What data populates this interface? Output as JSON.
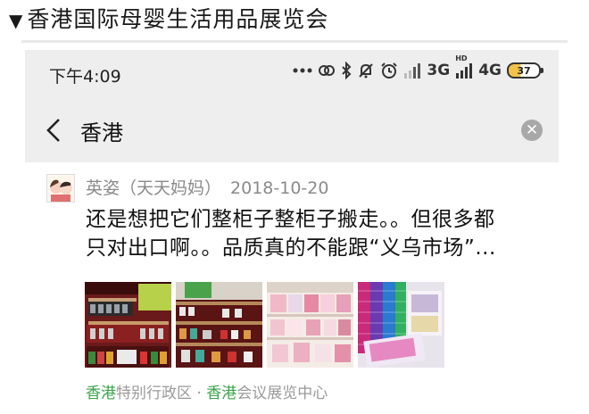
{
  "headline": {
    "marker": "▼",
    "text": "香港国际母婴生活用品展览会"
  },
  "status_bar": {
    "time": "下午4:09",
    "icons": [
      "more-dots-icon",
      "link-icon",
      "bluetooth-icon",
      "mute-bell-icon",
      "alarm-clock-icon",
      "signal-icon",
      "signal-icon"
    ],
    "network_1": "3G",
    "network_1_sup": "HD",
    "network_2": "4G",
    "battery": "37",
    "battery_color": "#f3c24a"
  },
  "search": {
    "query": "香港",
    "back_icon": "chevron-left-icon",
    "clear_icon": "clear-circle-icon"
  },
  "post": {
    "author": "英姿（天天妈妈）",
    "date": "2018-10-20",
    "text_line_1": "还是想把它们整柜子整柜子搬走。。但很多都",
    "text_line_2": "只对出口啊。。品质真的不能跟“义乌市场”...",
    "location_city": "香港",
    "location_rest_1": "特别行政区 · ",
    "location_venue_hl": "香港",
    "location_rest_2": "会议展览中心",
    "location_color": "#3aa34a"
  }
}
